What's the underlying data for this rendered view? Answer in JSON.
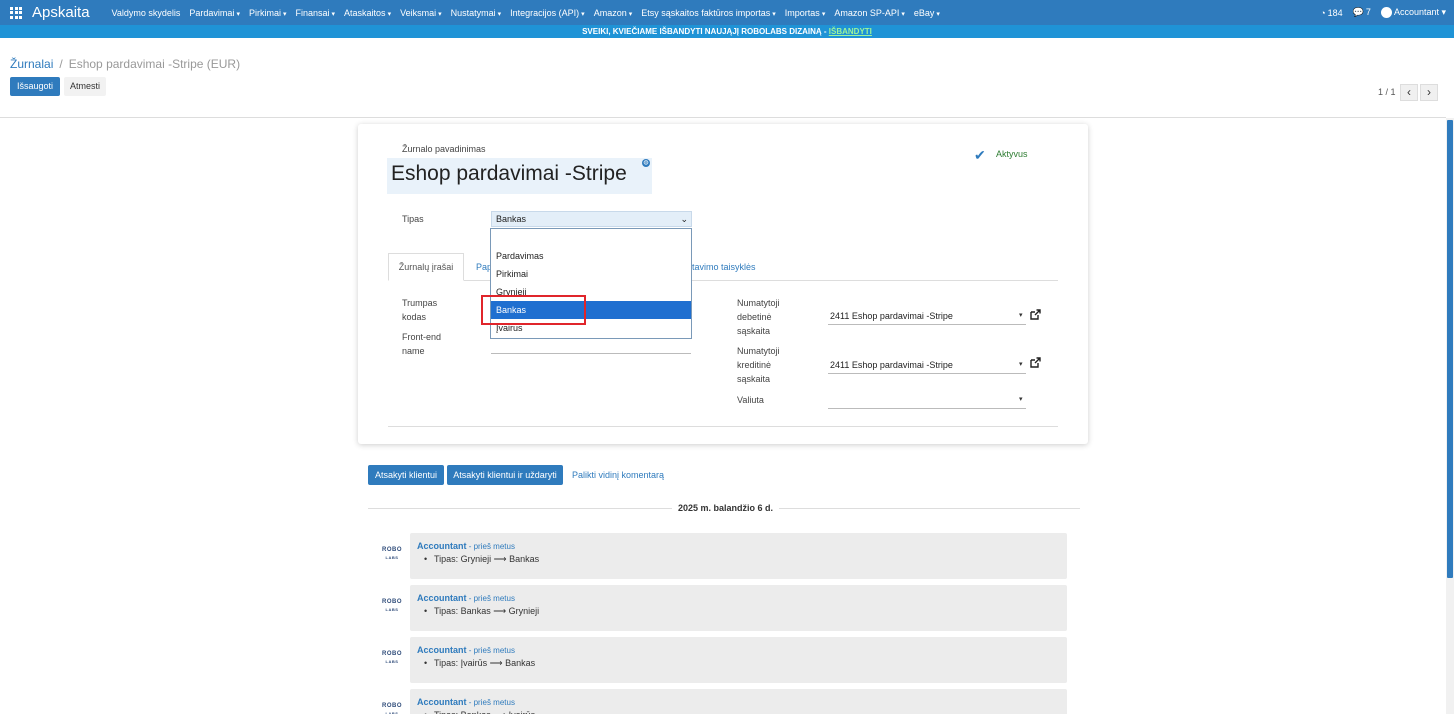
{
  "nav": {
    "brand": "Apskaita",
    "items": [
      {
        "label": "Valdymo skydelis",
        "caret": false
      },
      {
        "label": "Pardavimai",
        "caret": true
      },
      {
        "label": "Pirkimai",
        "caret": true
      },
      {
        "label": "Finansai",
        "caret": true
      },
      {
        "label": "Ataskaitos",
        "caret": true
      },
      {
        "label": "Veiksmai",
        "caret": true
      },
      {
        "label": "Nustatymai",
        "caret": true
      },
      {
        "label": "Integracijos (API)",
        "caret": true
      },
      {
        "label": "Amazon",
        "caret": true
      },
      {
        "label": "Etsy sąskaitos faktūros importas",
        "caret": true
      },
      {
        "label": "Importas",
        "caret": true
      },
      {
        "label": "Amazon SP-API",
        "caret": true
      },
      {
        "label": "eBay",
        "caret": true
      }
    ],
    "notifications": "184",
    "messages": "7",
    "user": "Accountant"
  },
  "banner": {
    "text": "SVEIKI, KVIEČIAME IŠBANDYTI NAUJĄJĮ ROBOLABS DIZAINĄ - ",
    "link": "IŠBANDYTI"
  },
  "breadcrumb": {
    "parent": "Žurnalai",
    "separator": "/",
    "current": "Eshop pardavimai -Stripe (EUR)"
  },
  "buttons": {
    "save": "Išsaugoti",
    "discard": "Atmesti"
  },
  "pager": {
    "value": "1 / 1",
    "prev": "‹",
    "next": "›"
  },
  "form": {
    "name_label": "Žurnalo pavadinimas",
    "name_value": "Eshop pardavimai -Stripe",
    "active_label": "Aktyvus",
    "type_label": "Tipas",
    "type_value": "Bankas",
    "type_options": [
      "",
      "Pardavimas",
      "Pirkimai",
      "Grynieji",
      "Bankas",
      "Įvairus"
    ],
    "selected_option_index": 4,
    "tabs": {
      "t1": "Žurnalų įrašai",
      "t2_start": "Pap",
      "t3_end": "tavimo taisyklės"
    },
    "short_code_label_1": "Trumpas",
    "short_code_label_2": "kodas",
    "frontend_label_1": "Front-end",
    "frontend_label_2": "name",
    "debit_label_1": "Numatytoji",
    "debit_label_2": "debetinė",
    "debit_label_3": "sąskaita",
    "debit_value": "2411 Eshop pardavimai -Stripe",
    "credit_label_1": "Numatytoji",
    "credit_label_2": "kreditinė",
    "credit_label_3": "sąskaita",
    "credit_value": "2411 Eshop pardavimai -Stripe",
    "currency_label": "Valiuta",
    "currency_value": ""
  },
  "chatter": {
    "reply_button": "Atsakyti klientui",
    "reply_close_button": "Atsakyti klientui ir uždaryti",
    "internal_note": "Palikti vidinį komentarą",
    "date": "2025 m. balandžio 6 d.",
    "avatar_top": "ROBO",
    "avatar_bottom": "LABS",
    "messages": [
      {
        "author": "Accountant",
        "time": " - prieš metus",
        "change": "Tipas: Grynieji ⟶ Bankas"
      },
      {
        "author": "Accountant",
        "time": " - prieš metus",
        "change": "Tipas: Bankas ⟶ Grynieji"
      },
      {
        "author": "Accountant",
        "time": " - prieš metus",
        "change": "Tipas: Įvairūs ⟶ Bankas"
      },
      {
        "author": "Accountant",
        "time": " - prieš metus",
        "change": "Tipas: Bankas ⟶ Įvairūs"
      }
    ]
  },
  "colors": {
    "primary": "#2f7bbd",
    "banner": "#1f93d6",
    "selected_option": "#1f6fd0",
    "highlight": "#e0252b"
  }
}
